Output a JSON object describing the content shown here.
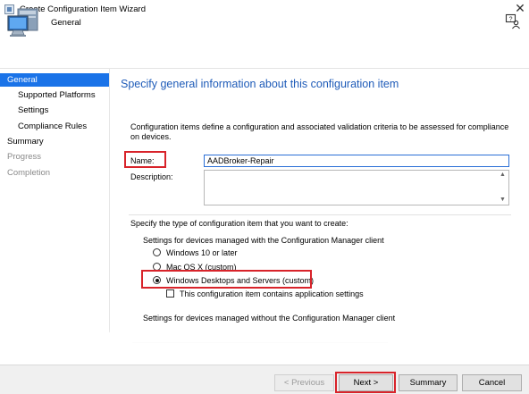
{
  "window": {
    "title": "Create Configuration Item Wizard",
    "close_glyph": "✕"
  },
  "header": {
    "title": "General"
  },
  "nav": {
    "items": [
      {
        "label": "General"
      },
      {
        "label": "Supported Platforms"
      },
      {
        "label": "Settings"
      },
      {
        "label": "Compliance Rules"
      },
      {
        "label": "Summary"
      },
      {
        "label": "Progress"
      },
      {
        "label": "Completion"
      }
    ]
  },
  "page": {
    "heading": "Specify general information about this configuration item",
    "intro": "Configuration items define a configuration and associated validation criteria to be assessed for compliance on devices.",
    "name_label": "Name:",
    "name_value": "AADBroker-Repair",
    "description_label": "Description:",
    "description_value": "",
    "type_prompt": "Specify the type of configuration item that you want to create:",
    "managed_group_label": "Settings for devices managed with the Configuration Manager client",
    "options": [
      {
        "label": "Windows 10 or later",
        "selected": false
      },
      {
        "label": "Mac OS X (custom)",
        "selected": false
      },
      {
        "label": "Windows Desktops and Servers (custom)",
        "selected": true
      }
    ],
    "app_settings_checkbox": {
      "label": "This configuration item contains application settings",
      "checked": false
    },
    "unmanaged_group_label": "Settings for devices managed without the Configuration Manager client"
  },
  "buttons": {
    "previous": "< Previous",
    "next": "Next >",
    "summary": "Summary",
    "cancel": "Cancel"
  },
  "colors": {
    "highlight": "#d8232a",
    "nav_active": "#1a73e8",
    "heading": "#1e5bb8"
  }
}
